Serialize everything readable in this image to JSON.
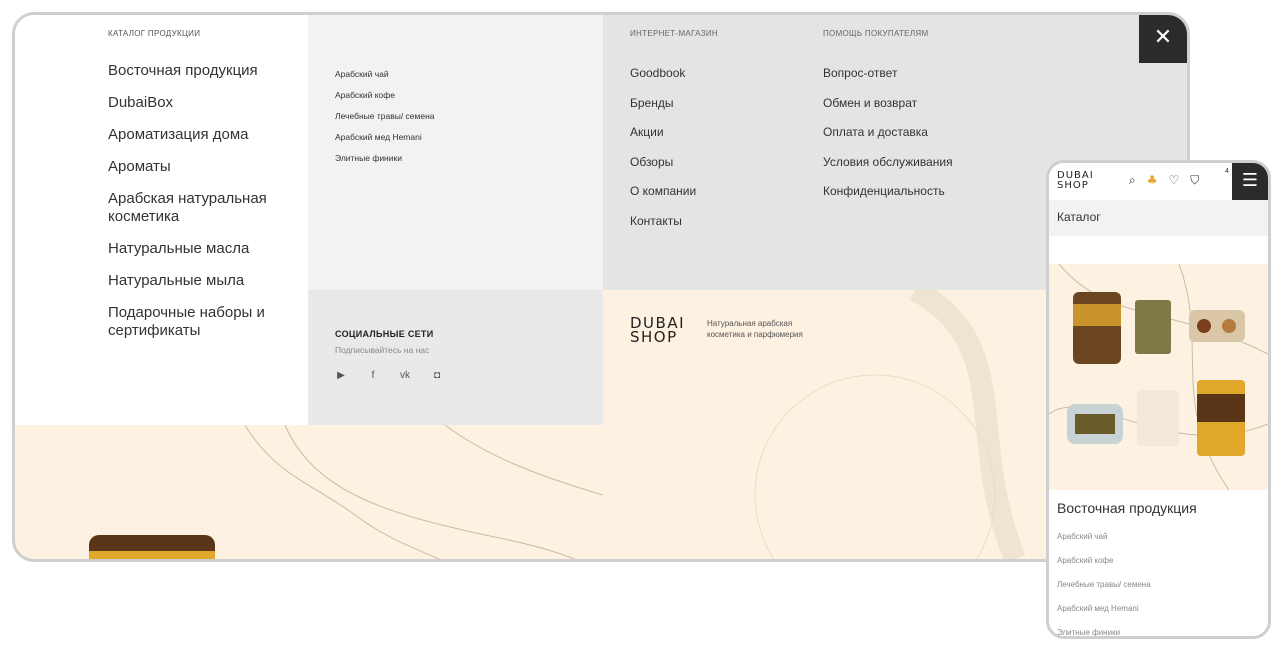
{
  "catalog": {
    "heading": "КАТАЛОГ ПРОДУКЦИИ",
    "items": [
      "Восточная продукция",
      "DubaiBox",
      "Ароматизация дома",
      "Ароматы",
      "Арабская натуральная косметика",
      "Натуральные масла",
      "Натуральные мыла",
      "Подарочные наборы и сертификаты"
    ]
  },
  "subcategories": [
    "Арабский чай",
    "Арабский кофе",
    "Лечебные травы/ семена",
    "Арабский мед Hemani",
    "Элитные финики"
  ],
  "social": {
    "title": "СОЦИАЛЬНЫЕ СЕТИ",
    "subtitle": "Подписывайтесь на нас",
    "icons": [
      "youtube-icon",
      "facebook-icon",
      "vk-icon",
      "instagram-icon"
    ],
    "glyphs": [
      "▶",
      "f",
      "vk",
      "◘"
    ]
  },
  "shop": {
    "heading": "ИНТЕРНЕТ-МАГАЗИН",
    "items": [
      "Goodbook",
      "Бренды",
      "Акции",
      "Обзоры",
      "О компании",
      "Контакты"
    ]
  },
  "help": {
    "heading": "ПОМОЩЬ ПОКУПАТЕЛЯМ",
    "items": [
      "Вопрос-ответ",
      "Обмен и возврат",
      "Оплата и доставка",
      "Условия обслуживания",
      "Конфиденциальность"
    ]
  },
  "brand": {
    "logo_line1": "DUBAI",
    "logo_line2": "SHOP",
    "tagline_line1": "Натуральная арабская",
    "tagline_line2": "косметика и парфюмерия"
  },
  "close_glyph": "✕",
  "mobile": {
    "cart_count": "4",
    "icons": [
      "search-icon",
      "user-icon",
      "heart-icon",
      "cart-icon"
    ],
    "icon_glyphs": [
      "⌕",
      "♣",
      "♡",
      "⛉"
    ],
    "menu_glyph": "☰",
    "catalog_label": "Каталог",
    "section_title": "Восточная продукция",
    "sub_items": [
      "Арабский чай",
      "Арабский кофе",
      "Лечебные травы/ семена",
      "Арабский мед Hemani",
      "Элитные финики"
    ]
  },
  "colors": {
    "accent_beige": "#fdf1e1",
    "dark": "#2b2b2b",
    "accent_gold": "#e0a72b"
  }
}
